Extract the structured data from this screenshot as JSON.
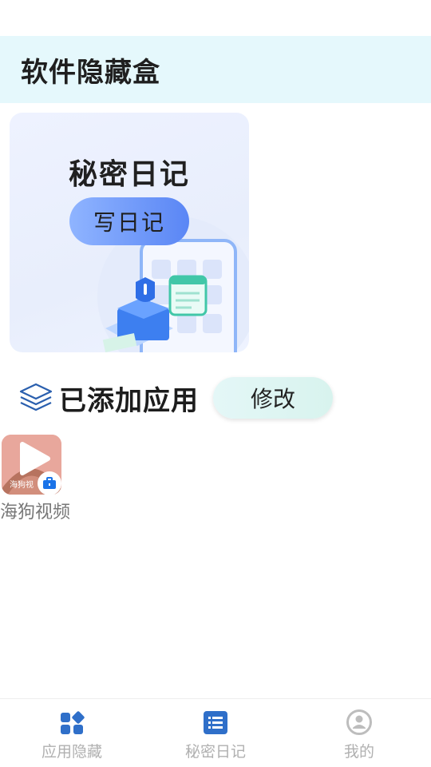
{
  "header": {
    "title": "软件隐藏盒"
  },
  "diary_card": {
    "title": "秘密日记",
    "button_label": "写日记"
  },
  "section": {
    "title": "已添加应用",
    "modify_label": "修改"
  },
  "apps": [
    {
      "name": "海狗视频",
      "icon": "play-icon",
      "icon_text": "海狗视"
    }
  ],
  "bottom_nav": [
    {
      "label": "应用隐藏",
      "icon": "apps-grid-icon",
      "active": true
    },
    {
      "label": "秘密日记",
      "icon": "list-icon",
      "active": false
    },
    {
      "label": "我的",
      "icon": "profile-icon",
      "active": false
    }
  ],
  "colors": {
    "header_bg": "#e5f8fc",
    "accent": "#2f6fc9",
    "inactive": "#b0b0b0",
    "app_icon_bg": "#e6a8a0"
  }
}
